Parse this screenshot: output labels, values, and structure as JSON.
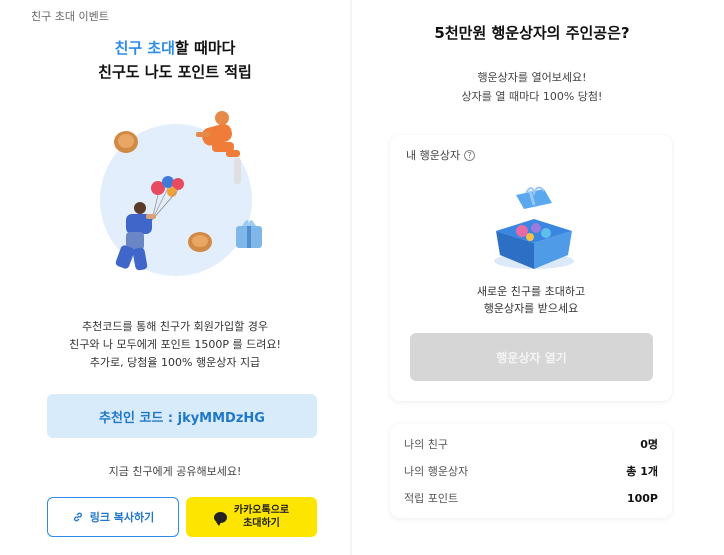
{
  "left": {
    "event_label": "친구 초대 이벤트",
    "headline_accent": "친구 초대",
    "headline_rest_1": "할 때마다",
    "headline_line_2": "친구도 나도 포인트 적립",
    "desc_lines": [
      "추천코드를 통해 친구가 회원가입할 경우",
      "친구와 나 모두에게 포인트 1500P 를 드려요!",
      "추가로, 당첨율 100% 행운상자 지급"
    ],
    "referral_code": "추천인 코드 : jkyMMDzHG",
    "share_hint": "지금 친구에게 공유해보세요!",
    "link_button": "링크 복사하기",
    "kakao_button_line1": "카카오톡으로",
    "kakao_button_line2": "초대하기"
  },
  "right": {
    "title": "5천만원 행운상자의 주인공은?",
    "subtitle_lines": [
      "행운상자를 열어보세요!",
      "상자를 열 때마다 100% 당첨!"
    ],
    "card_label": "내 행운상자",
    "help_icon": "?",
    "card_msg_lines": [
      "새로운 친구를 초대하고",
      "행운상자를 받으세요"
    ],
    "open_button": "행운상자 열기",
    "stats": [
      {
        "label": "나의 친구",
        "value": "0명"
      },
      {
        "label": "나의 행운상자",
        "value": "총 1개"
      },
      {
        "label": "적립 포인트",
        "value": "100P"
      }
    ]
  },
  "colors": {
    "accent": "#2e8ce6",
    "code_bg": "#d8ebfb",
    "kakao": "#fde500",
    "disabled": "#d6d6d6"
  }
}
